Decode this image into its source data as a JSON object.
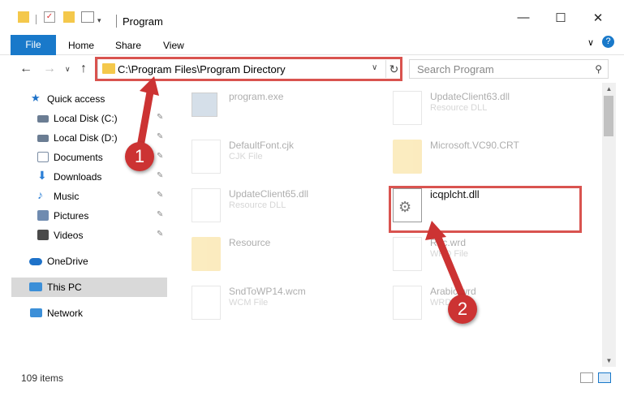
{
  "window": {
    "title": "Program",
    "minimize_icon": "minimize-icon",
    "maximize_icon": "maximize-icon",
    "close_icon": "close-icon",
    "help_icon": "help-icon"
  },
  "ribbon": {
    "tabs": [
      {
        "label": "File"
      },
      {
        "label": "Home"
      },
      {
        "label": "Share"
      },
      {
        "label": "View"
      }
    ]
  },
  "address": {
    "path": "C:\\Program Files\\Program Directory"
  },
  "search": {
    "placeholder": "Search Program"
  },
  "sidebar": {
    "items": [
      {
        "label": "Quick access",
        "icon": "star-icon",
        "color": "#1e72c9"
      },
      {
        "label": "Local Disk (C:)",
        "icon": "drive-icon",
        "color": "#6b7d93"
      },
      {
        "label": "Local Disk (D:)",
        "icon": "drive-icon",
        "color": "#6b7d93"
      },
      {
        "label": "Documents",
        "icon": "documents-icon",
        "color": "#7a8ca3"
      },
      {
        "label": "Downloads",
        "icon": "download-icon",
        "color": "#2b7fd6"
      },
      {
        "label": "Music",
        "icon": "music-icon",
        "color": "#2b7fd6"
      },
      {
        "label": "Pictures",
        "icon": "pictures-icon",
        "color": "#6f8bb0"
      },
      {
        "label": "Videos",
        "icon": "videos-icon",
        "color": "#4a4a4a"
      },
      {
        "label": "OneDrive",
        "icon": "cloud-icon",
        "color": "#1e72c9"
      },
      {
        "label": "This PC",
        "icon": "computer-icon",
        "color": "#3c8fd8"
      },
      {
        "label": "Network",
        "icon": "network-icon",
        "color": "#3c8fd8"
      }
    ]
  },
  "files": [
    {
      "name": "program.exe",
      "type": "",
      "icon": "exe-icon"
    },
    {
      "name": "UpdateClient63.dll",
      "type": "Resource DLL",
      "icon": "dll-icon"
    },
    {
      "name": "DefaultFont.cjk",
      "type": "CJK File",
      "icon": "file-icon"
    },
    {
      "name": "Microsoft.VC90.CRT",
      "type": "",
      "icon": "folder-icon"
    },
    {
      "name": "UpdateClient65.dll",
      "type": "Resource DLL",
      "icon": "dll-icon"
    },
    {
      "name": "icqplcht.dll",
      "type": "",
      "icon": "dll-icon"
    },
    {
      "name": "Resource",
      "type": "",
      "icon": "folder-icon"
    },
    {
      "name": "Rec.wrd",
      "type": "WRD File",
      "icon": "file-icon"
    },
    {
      "name": "SndToWP14.wcm",
      "type": "WCM File",
      "icon": "file-icon"
    },
    {
      "name": "Arabic.wrd",
      "type": "WRD File",
      "icon": "file-icon"
    }
  ],
  "status": {
    "item_count": "109 items"
  },
  "callouts": [
    "1",
    "2"
  ],
  "colors": {
    "accent": "#1979ca",
    "highlight": "#d9534f",
    "callout": "#cc3333"
  }
}
